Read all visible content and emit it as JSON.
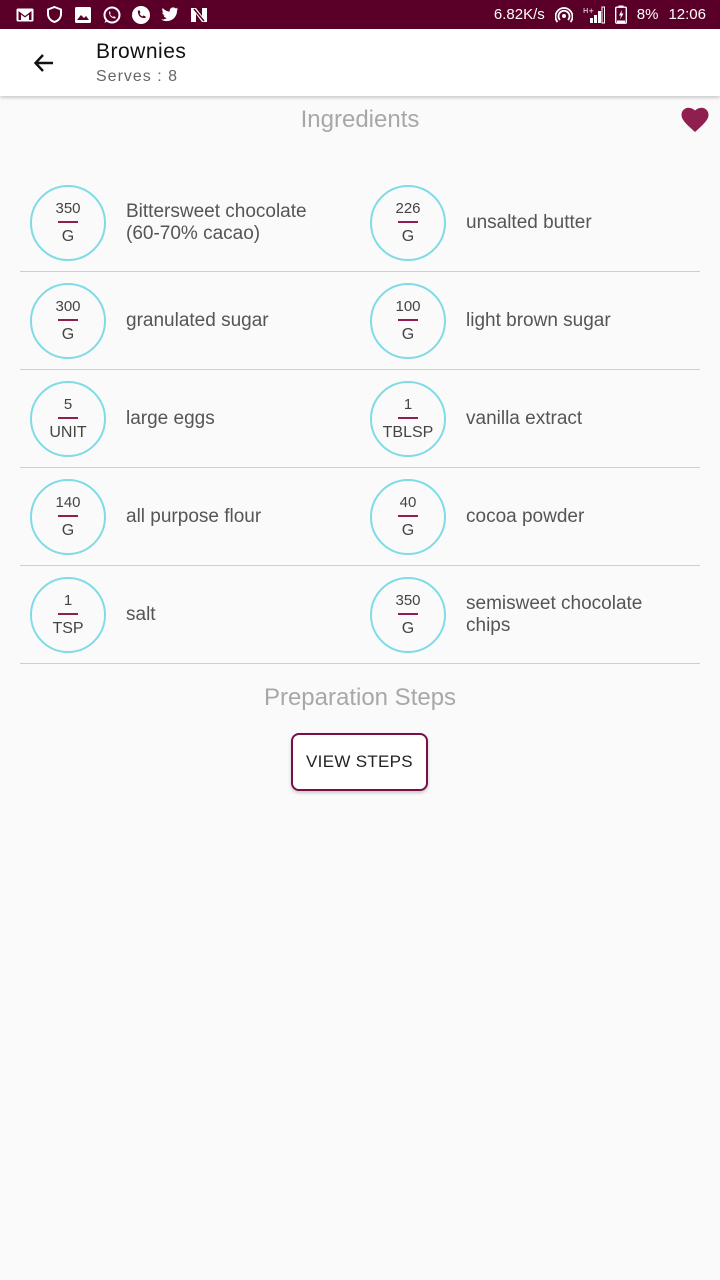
{
  "status_bar": {
    "left_icons": [
      "gmail-icon",
      "shield-icon",
      "image-icon",
      "whatsapp-icon",
      "phone-icon",
      "twitter-icon",
      "n-icon"
    ],
    "speed": "6.82K/s",
    "battery": "8%",
    "time": "12:06",
    "color": "#5a0028"
  },
  "app_bar": {
    "title": "Brownies",
    "subtitle": "Serves : 8"
  },
  "ingredients_title": "Ingredients",
  "ingredients": [
    {
      "qty": "350",
      "unit": "G",
      "name": "Bittersweet chocolate (60-70% cacao)"
    },
    {
      "qty": "226",
      "unit": "G",
      "name": "unsalted butter"
    },
    {
      "qty": "300",
      "unit": "G",
      "name": "granulated sugar"
    },
    {
      "qty": "100",
      "unit": "G",
      "name": "light brown sugar"
    },
    {
      "qty": "5",
      "unit": "UNIT",
      "name": "large eggs"
    },
    {
      "qty": "1",
      "unit": "TBLSP",
      "name": "vanilla extract"
    },
    {
      "qty": "140",
      "unit": "G",
      "name": "all purpose flour"
    },
    {
      "qty": "40",
      "unit": "G",
      "name": "cocoa powder"
    },
    {
      "qty": "1",
      "unit": "TSP",
      "name": "salt"
    },
    {
      "qty": "350",
      "unit": "G",
      "name": "semisweet chocolate chips"
    }
  ],
  "prep_title": "Preparation Steps",
  "view_steps_label": "VIEW STEPS",
  "colors": {
    "accent": "#8e1f4f",
    "circle_border": "#7fdbe6",
    "favorite": "#8e1f4f"
  }
}
